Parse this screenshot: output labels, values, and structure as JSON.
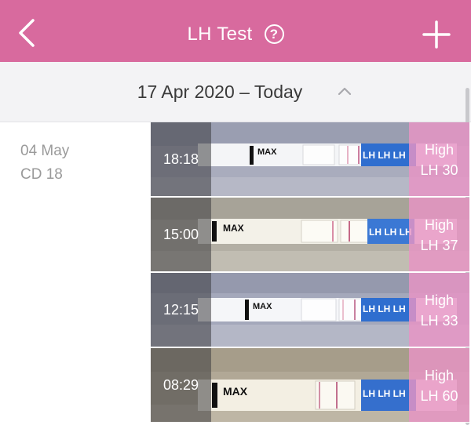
{
  "header": {
    "title": "LH Test",
    "help_glyph": "?",
    "back_icon": "chevron-left-icon",
    "add_icon": "plus-icon",
    "color": "#d86a9e"
  },
  "date_range": {
    "label": "17 Apr 2020 – Today",
    "caret_icon": "chevron-up-icon"
  },
  "day": {
    "date": "04 May",
    "cycle_day": "CD 18"
  },
  "tests": [
    {
      "time": "18:18",
      "level": "High",
      "value": "LH 30"
    },
    {
      "time": "15:00",
      "level": "High",
      "value": "LH 37"
    },
    {
      "time": "12:15",
      "level": "High",
      "value": "LH 33"
    },
    {
      "time": "08:29",
      "level": "High",
      "value": "LH 60"
    }
  ],
  "strip_text": {
    "max": "MAX",
    "lh": "LH LH LH"
  }
}
